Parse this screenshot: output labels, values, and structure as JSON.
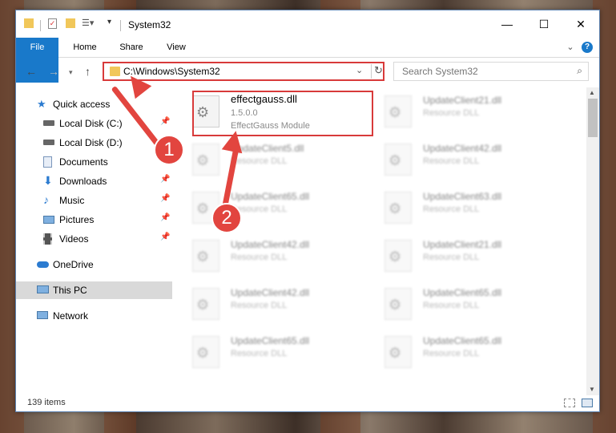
{
  "window": {
    "title": "System32"
  },
  "ribbon": {
    "tabs": [
      "File",
      "Home",
      "Share",
      "View"
    ]
  },
  "address": {
    "path": "C:\\Windows\\System32"
  },
  "search": {
    "placeholder": "Search System32"
  },
  "sidebar": {
    "items": [
      {
        "label": "Quick access",
        "pinned": false
      },
      {
        "label": "Local Disk (C:)",
        "pinned": true
      },
      {
        "label": "Local Disk (D:)",
        "pinned": false
      },
      {
        "label": "Documents",
        "pinned": false
      },
      {
        "label": "Downloads",
        "pinned": true
      },
      {
        "label": "Music",
        "pinned": true
      },
      {
        "label": "Pictures",
        "pinned": true
      },
      {
        "label": "Videos",
        "pinned": true
      },
      {
        "label": "OneDrive",
        "pinned": false
      },
      {
        "label": "This PC",
        "pinned": false
      },
      {
        "label": "Network",
        "pinned": false
      }
    ],
    "active": "This PC"
  },
  "files": {
    "highlighted": {
      "name": "effectgauss.dll",
      "version": "1.5.0.0",
      "description": "EffectGauss Module"
    },
    "items": [
      {
        "name": "UpdateClient21.dll",
        "type": "Resource DLL"
      },
      {
        "name": "UpdateClient5.dll",
        "type": "Resource DLL"
      },
      {
        "name": "UpdateClient42.dll",
        "type": "Resource DLL"
      },
      {
        "name": "UpdateClient65.dll",
        "type": "Resource DLL"
      },
      {
        "name": "UpdateClient63.dll",
        "type": "Resource DLL"
      },
      {
        "name": "UpdateClient42.dll",
        "type": "Resource DLL"
      },
      {
        "name": "UpdateClient21.dll",
        "type": "Resource DLL"
      },
      {
        "name": "UpdateClient42.dll",
        "type": "Resource DLL"
      },
      {
        "name": "UpdateClient65.dll",
        "type": "Resource DLL"
      },
      {
        "name": "UpdateClient65.dll",
        "type": "Resource DLL"
      },
      {
        "name": "UpdateClient65.dll",
        "type": "Resource DLL"
      }
    ]
  },
  "status": {
    "item_count": "139 items"
  },
  "annotations": {
    "step1": "1",
    "step2": "2",
    "color": "#e2453f"
  }
}
